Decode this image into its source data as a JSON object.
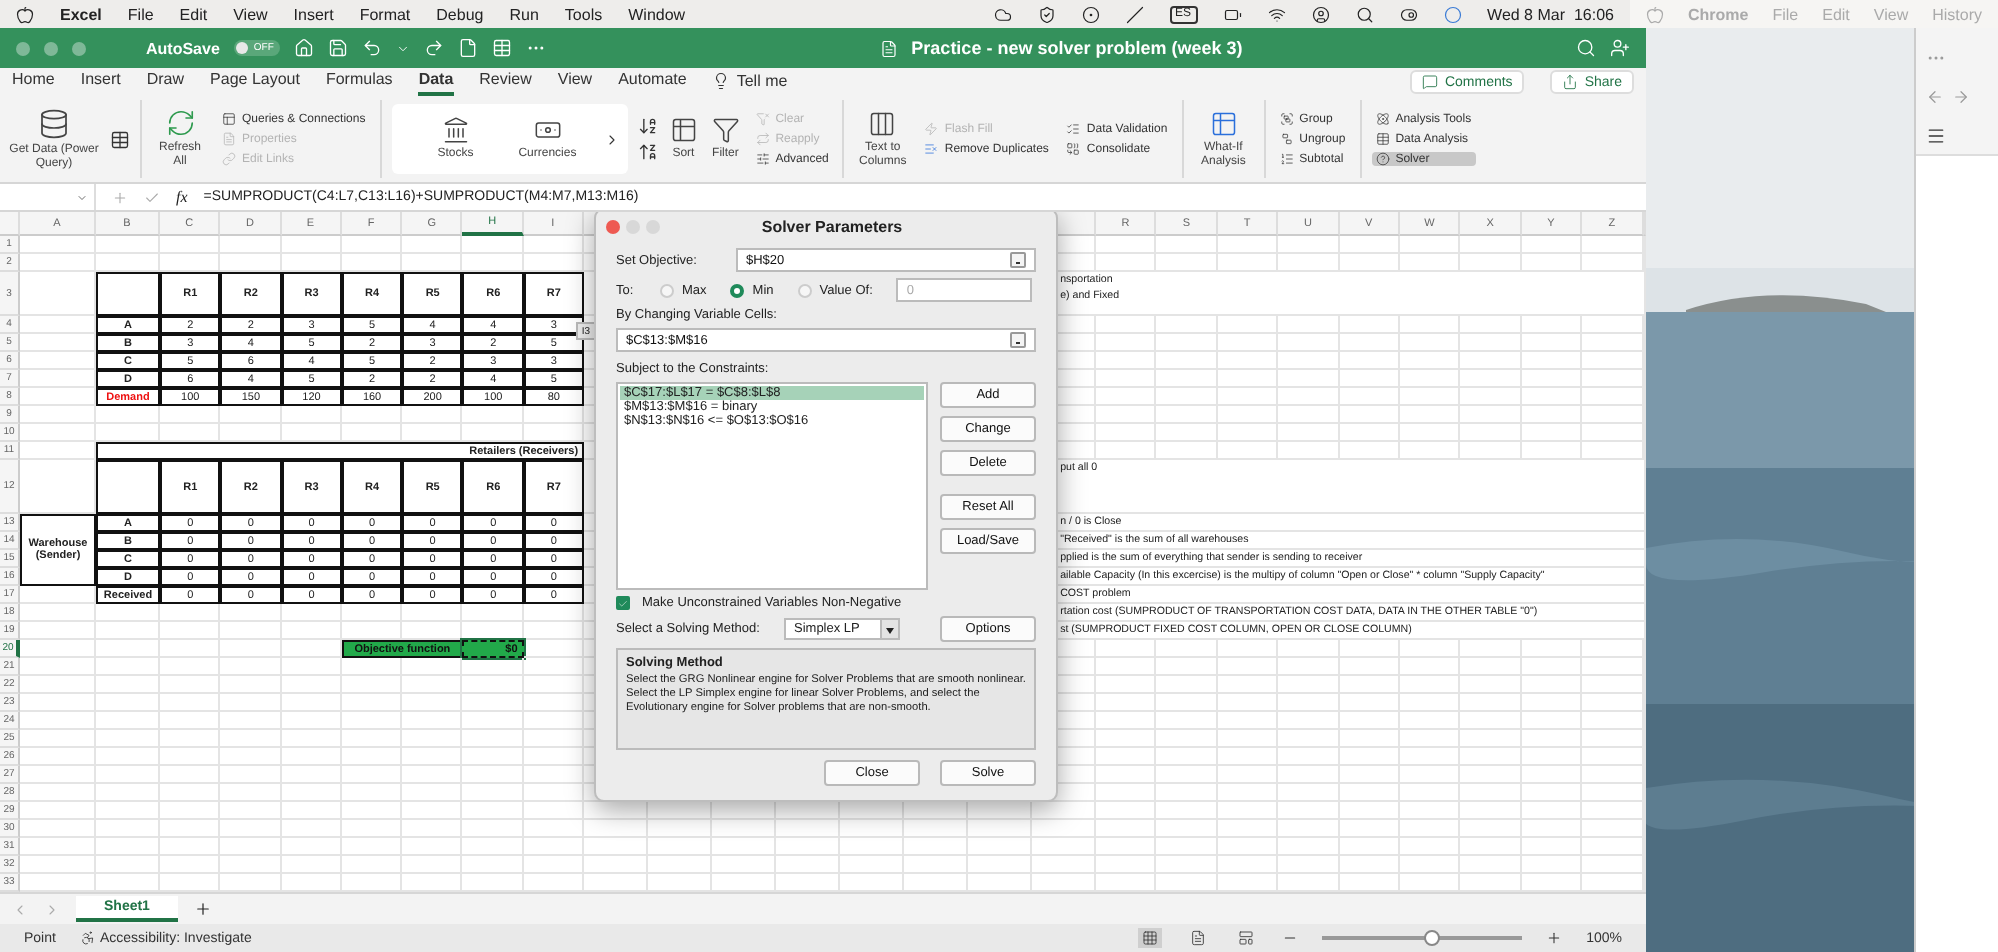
{
  "menu_bar": {
    "app": "Excel",
    "items": [
      "File",
      "Edit",
      "View",
      "Insert",
      "Format",
      "Debug",
      "Run",
      "Tools",
      "Window"
    ],
    "input_source": "ES",
    "clock": "Wed 8 Mar  16:06"
  },
  "title_bar": {
    "autosave": {
      "label": "AutoSave",
      "state": "OFF",
      "on": false
    },
    "title": "Practice - new solver problem (week 3)"
  },
  "ribbon_tabs": [
    {
      "label": "Home",
      "selected": false
    },
    {
      "label": "Insert",
      "selected": false
    },
    {
      "label": "Draw",
      "selected": false
    },
    {
      "label": "Page Layout",
      "selected": false
    },
    {
      "label": "Formulas",
      "selected": false
    },
    {
      "label": "Data",
      "selected": true
    },
    {
      "label": "Review",
      "selected": false
    },
    {
      "label": "View",
      "selected": false
    },
    {
      "label": "Automate",
      "selected": false
    }
  ],
  "tell_me": "Tell me",
  "actions": [
    "Comments",
    "Share"
  ],
  "ribbon": {
    "get_data": "Get Data (Power Query)",
    "refresh": "Refresh All",
    "queries": [
      {
        "label": "Queries & Connections",
        "disabled": false
      },
      {
        "label": "Properties",
        "disabled": true
      },
      {
        "label": "Edit Links",
        "disabled": true
      }
    ],
    "data_types": [
      "Stocks",
      "Currencies"
    ],
    "sort": "Sort",
    "filter": "Filter",
    "filter_options": [
      {
        "label": "Clear",
        "disabled": true
      },
      {
        "label": "Reapply",
        "disabled": true
      },
      {
        "label": "Advanced",
        "disabled": false
      }
    ],
    "text_to_columns": "Text to Columns",
    "data_tools": [
      {
        "label": "Flash Fill",
        "disabled": true
      },
      {
        "label": "Remove Duplicates",
        "disabled": false
      }
    ],
    "validation": [
      "Data Validation",
      "Consolidate"
    ],
    "what_if": "What-If Analysis",
    "outline": [
      "Group",
      "Ungroup",
      "Subtotal"
    ],
    "analysis": [
      {
        "label": "Analysis Tools",
        "selected": false
      },
      {
        "label": "Data Analysis",
        "selected": false
      },
      {
        "label": "Solver",
        "selected": true
      }
    ]
  },
  "formula_bar": {
    "fx_label": "fx",
    "formula": "=SUMPRODUCT(C4:L7,C13:L16)+SUMPRODUCT(M4:M7,M13:M16)"
  },
  "sheet": {
    "columns_left": [
      {
        "label": "A",
        "selected": false
      },
      {
        "label": "B",
        "selected": false
      },
      {
        "label": "C",
        "selected": false
      },
      {
        "label": "D",
        "selected": false
      },
      {
        "label": "E",
        "selected": false
      },
      {
        "label": "F",
        "selected": false
      },
      {
        "label": "G",
        "selected": false
      },
      {
        "label": "H",
        "selected": true
      },
      {
        "label": "I",
        "selected": false
      }
    ],
    "columns_right": [
      {
        "label": "R",
        "selected": false
      },
      {
        "label": "S",
        "selected": false
      },
      {
        "label": "T",
        "selected": false
      },
      {
        "label": "U",
        "selected": false
      },
      {
        "label": "V",
        "selected": false
      },
      {
        "label": "W",
        "selected": false
      },
      {
        "label": "X",
        "selected": false
      },
      {
        "label": "Y",
        "selected": false
      },
      {
        "label": "Z",
        "selected": false
      }
    ],
    "rows": [
      {
        "label": "1",
        "selected": false
      },
      {
        "label": "2",
        "selected": false
      },
      {
        "label": "3",
        "selected": false
      },
      {
        "label": "4",
        "selected": false
      },
      {
        "label": "5",
        "selected": false
      },
      {
        "label": "6",
        "selected": false
      },
      {
        "label": "7",
        "selected": false
      },
      {
        "label": "8",
        "selected": false
      },
      {
        "label": "9",
        "selected": false
      },
      {
        "label": "10",
        "selected": false
      },
      {
        "label": "11",
        "selected": false
      },
      {
        "label": "12",
        "selected": false
      },
      {
        "label": "13",
        "selected": false
      },
      {
        "label": "14",
        "selected": false
      },
      {
        "label": "15",
        "selected": false
      },
      {
        "label": "16",
        "selected": false
      },
      {
        "label": "17",
        "selected": false
      },
      {
        "label": "18",
        "selected": false
      },
      {
        "label": "19",
        "selected": false
      },
      {
        "label": "20",
        "selected": true
      },
      {
        "label": "21",
        "selected": false
      },
      {
        "label": "22",
        "selected": false
      },
      {
        "label": "23",
        "selected": false
      },
      {
        "label": "24",
        "selected": false
      },
      {
        "label": "25",
        "selected": false
      },
      {
        "label": "26",
        "selected": false
      },
      {
        "label": "27",
        "selected": false
      },
      {
        "label": "28",
        "selected": false
      },
      {
        "label": "29",
        "selected": false
      },
      {
        "label": "30",
        "selected": false
      },
      {
        "label": "31",
        "selected": false
      },
      {
        "label": "32",
        "selected": false
      },
      {
        "label": "33",
        "selected": false
      }
    ]
  },
  "cost_table": {
    "headers": [
      "R1",
      "R2",
      "R3",
      "R4",
      "R5",
      "R6",
      "R7"
    ],
    "rows": [
      {
        "label": "A",
        "values": [
          "2",
          "2",
          "3",
          "5",
          "4",
          "4",
          "3"
        ]
      },
      {
        "label": "B",
        "values": [
          "3",
          "4",
          "5",
          "2",
          "3",
          "2",
          "5"
        ]
      },
      {
        "label": "C",
        "values": [
          "5",
          "6",
          "4",
          "5",
          "2",
          "3",
          "3"
        ]
      },
      {
        "label": "D",
        "values": [
          "6",
          "4",
          "5",
          "2",
          "2",
          "4",
          "5"
        ]
      }
    ],
    "demand": {
      "label": "Demand",
      "values": [
        "100",
        "150",
        "120",
        "160",
        "200",
        "100",
        "80"
      ]
    }
  },
  "shipment_table": {
    "title": "Retailers (Receivers)",
    "side_label": "Warehouse (Sender)",
    "headers": [
      "R1",
      "R2",
      "R3",
      "R4",
      "R5",
      "R6",
      "R7"
    ],
    "rows": [
      {
        "label": "A",
        "values": [
          "0",
          "0",
          "0",
          "0",
          "0",
          "0",
          "0"
        ]
      },
      {
        "label": "B",
        "values": [
          "0",
          "0",
          "0",
          "0",
          "0",
          "0",
          "0"
        ]
      },
      {
        "label": "C",
        "values": [
          "0",
          "0",
          "0",
          "0",
          "0",
          "0",
          "0"
        ]
      },
      {
        "label": "D",
        "values": [
          "0",
          "0",
          "0",
          "0",
          "0",
          "0",
          "0"
        ]
      }
    ],
    "received": {
      "label": "Received",
      "values": [
        "0",
        "0",
        "0",
        "0",
        "0",
        "0",
        "0"
      ]
    }
  },
  "objective": {
    "label": "Objective function",
    "value": "$0"
  },
  "side_notes": [
    "nsportation",
    "e) and Fixed",
    "put all 0",
    "n / 0 is Close",
    "\"Received\" is the sum of all warehouses",
    "pplied is the sum of everything that sender is sending to receiver",
    "ailable Capacity (In this excercise) is the multipy of column \"Open or Close\" * column \"Supply Capacity\"",
    "COST problem",
    "rtation cost (SUMPRODUCT OF TRANSPORTATION COST DATA, DATA IN THE OTHER TABLE \"0\")",
    "st (SUMPRODUCT FIXED COST COLUMN, OPEN OR CLOSE COLUMN)"
  ],
  "cell_tag": "I3",
  "solver_dialog": {
    "title": "Solver Parameters",
    "objective_label": "Set Objective:",
    "objective": "$H$20",
    "to_label": "To:",
    "targets": [
      {
        "label": "Max",
        "selected": false
      },
      {
        "label": "Min",
        "selected": true
      },
      {
        "label": "Value Of:",
        "selected": false
      }
    ],
    "value_of": "0",
    "variables_label": "By Changing Variable Cells:",
    "variables": "$C$13:$M$16",
    "constraints_label": "Subject to the Constraints:",
    "constraints": [
      {
        "text": "$C$17:$L$17 = $C$8:$L$8",
        "selected": true
      },
      {
        "text": "$M$13:$M$16 = binary",
        "selected": false
      },
      {
        "text": "$N$13:$N$16 <= $O$13:$O$16",
        "selected": false
      }
    ],
    "constraint_buttons": [
      "Add",
      "Change",
      "Delete",
      "Reset All",
      "Load/Save"
    ],
    "non_negative": {
      "label": "Make Unconstrained Variables Non-Negative",
      "checked": true
    },
    "method_label": "Select a Solving Method:",
    "method": "Simplex LP",
    "options_button": "Options",
    "method_box": {
      "title": "Solving Method",
      "text": "Select the GRG Nonlinear engine for Solver Problems that are smooth nonlinear. Select the LP Simplex engine for linear Solver Problems, and select the Evolutionary engine for Solver problems that are non-smooth."
    },
    "buttons": [
      "Close",
      "Solve"
    ]
  },
  "sheet_tabs": [
    {
      "label": "Sheet1",
      "selected": true
    }
  ],
  "status_bar": {
    "mode": "Point",
    "accessibility": "Accessibility: Investigate",
    "views": [
      {
        "selected": true
      },
      {
        "selected": false
      },
      {
        "selected": false
      }
    ],
    "zoom": {
      "level": 0.55,
      "reading": "100%"
    }
  },
  "chrome": {
    "menu": [
      "Chrome",
      "File",
      "Edit",
      "View",
      "History"
    ]
  }
}
